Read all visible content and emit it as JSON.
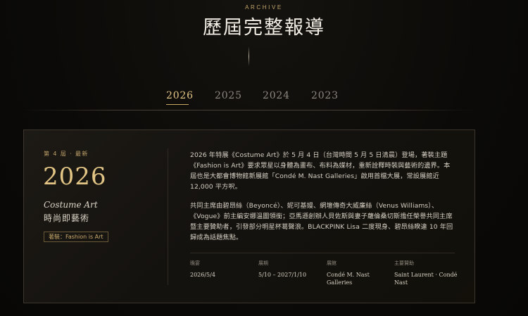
{
  "header": {
    "eyebrow": "ARCHIVE",
    "title": "歷屆完整報導"
  },
  "tabs": [
    {
      "label": "2026",
      "active": true
    },
    {
      "label": "2025",
      "active": false
    },
    {
      "label": "2024",
      "active": false
    },
    {
      "label": "2023",
      "active": false
    }
  ],
  "card": {
    "edition": "第 4 屆 · 最新",
    "year": "2026",
    "theme_en": "Costume Art",
    "theme_zh": "時尚即藝術",
    "dress_code": "著裝：Fashion is Art",
    "paragraphs": [
      "2026 年特展《Costume Art》於 5 月 4 日（台灣時間 5 月 5 日清晨）登場，著裝主題《Fashion is Art》要求眾星以身體為畫布、布料為媒材，重新詮釋時裝與藝術的邊界。本屆也是大都會博物館新展館「Condé M. Nast Galleries」啟用首檔大展，常設展館近 12,000 平方呎。",
      "共同主席由碧昂絲（Beyoncé）、妮可基嫚、網壇傳奇大威廉絲（Venus Williams）、《Vogue》前主編安娜溫圖領銜；亞馬遜創辦人貝佐斯與妻子蘿倫桑切斯擔任榮譽共同主席暨主要贊助者，引發部分明星杯葛聲浪。BLACKPINK Lisa 二度現身、碧昂絲睽違 10 年回歸成為話題焦點。"
    ],
    "meta": [
      {
        "label": "晚宴",
        "value": "2026/5/4"
      },
      {
        "label": "展期",
        "value": "5/10 – 2027/1/10"
      },
      {
        "label": "展館",
        "value": "Condé M. Nast Galleries"
      },
      {
        "label": "主要贊助",
        "value": "Saint Laurent · Condé Nast"
      }
    ]
  },
  "colors": {
    "accent_gold": "#e2c585",
    "background": "#0c0b09",
    "card_border": "#3b352b"
  }
}
